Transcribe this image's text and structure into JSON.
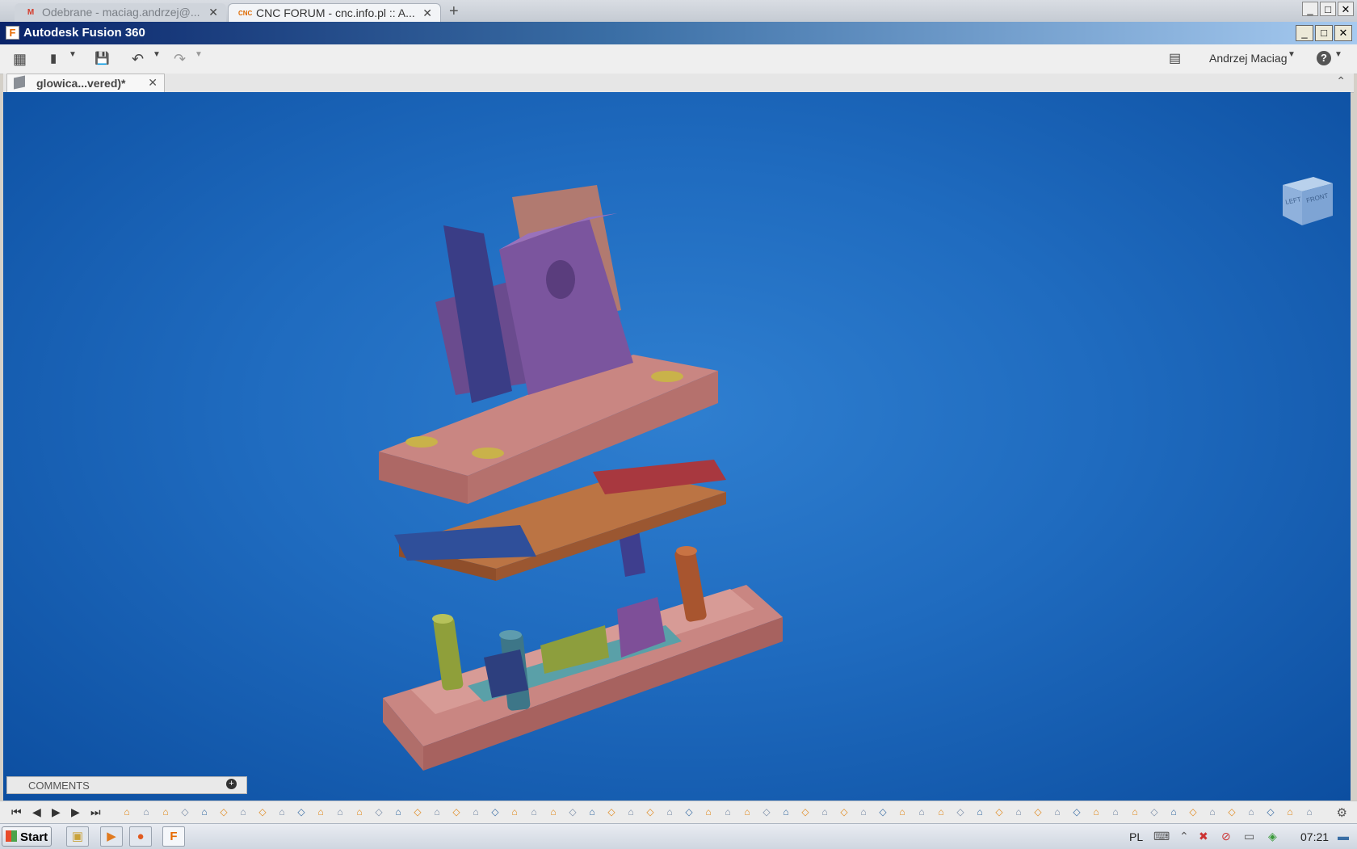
{
  "browser": {
    "tabs": [
      {
        "title": "Odebrane - maciag.andrzej@...",
        "icon": "gmail-icon",
        "active": false
      },
      {
        "title": "CNC FORUM - cnc.info.pl :: A...",
        "icon": "cnc-forum-icon",
        "active": true
      }
    ],
    "close_glyph": "✕",
    "new_tab_glyph": "+",
    "gmail_fav": "M",
    "cnc_fav": "CNC"
  },
  "app": {
    "title": "Autodesk Fusion 360",
    "logo_glyph": "F",
    "win_min": "_",
    "win_max": "□",
    "win_close": "✕"
  },
  "toolbar": {
    "grid_glyph": "▦",
    "file_glyph": "▮",
    "save_glyph": "💾",
    "undo_glyph": "↶",
    "redo_glyph": "↷",
    "caret_glyph": "▼",
    "comments_glyph": "▤",
    "user_name": "Andrzej Maciag",
    "help_glyph": "?"
  },
  "document": {
    "tab_label": "glowica...vered)*",
    "close_glyph": "✕",
    "collapse_glyph": "⌃"
  },
  "viewcube": {
    "left": "LEFT",
    "front": "FRONT"
  },
  "comments": {
    "label": "COMMENTS",
    "add_glyph": "+"
  },
  "timeline": {
    "first": "⏮",
    "prev": "◀",
    "play": "▶",
    "next": "▶",
    "last": "⏭",
    "settings_glyph": "⚙"
  },
  "taskbar": {
    "start_label": "Start",
    "lang": "PL",
    "clock": "07:21"
  },
  "colors": {
    "viewport_top": "#0c4ea0",
    "base_plate": "#c77e7b",
    "purple_part": "#7b559e",
    "orange_plate": "#b86a3f"
  }
}
